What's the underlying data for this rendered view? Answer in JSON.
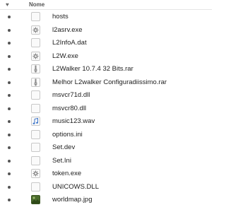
{
  "header": {
    "dot_glyph": "♥",
    "name_label": "Nome"
  },
  "files": [
    {
      "name": "hosts",
      "icon": "blank-file-icon"
    },
    {
      "name": "l2asrv.exe",
      "icon": "executable-icon"
    },
    {
      "name": "L2InfoA.dat",
      "icon": "blank-file-icon"
    },
    {
      "name": "L2W.exe",
      "icon": "executable-icon"
    },
    {
      "name": "L2Walker 10.7.4 32 Bits.rar",
      "icon": "archive-icon"
    },
    {
      "name": "Melhor L2walker Configuradiissimo.rar",
      "icon": "archive-icon"
    },
    {
      "name": "msvcr71d.dll",
      "icon": "blank-file-icon"
    },
    {
      "name": "msvcr80.dll",
      "icon": "blank-file-icon"
    },
    {
      "name": "music123.wav",
      "icon": "audio-icon"
    },
    {
      "name": "options.ini",
      "icon": "blank-file-icon"
    },
    {
      "name": "Set.dev",
      "icon": "blank-file-icon"
    },
    {
      "name": "Set.Ini",
      "icon": "blank-file-icon"
    },
    {
      "name": "token.exe",
      "icon": "executable-icon"
    },
    {
      "name": "UNICOWS.DLL",
      "icon": "blank-file-icon"
    },
    {
      "name": "worldmap.jpg",
      "icon": "image-icon"
    }
  ],
  "colors": {
    "audio_accent": "#3b73c8",
    "archive_stripe": "#8a8a8a",
    "image_thumb": "#4a6a2c"
  }
}
